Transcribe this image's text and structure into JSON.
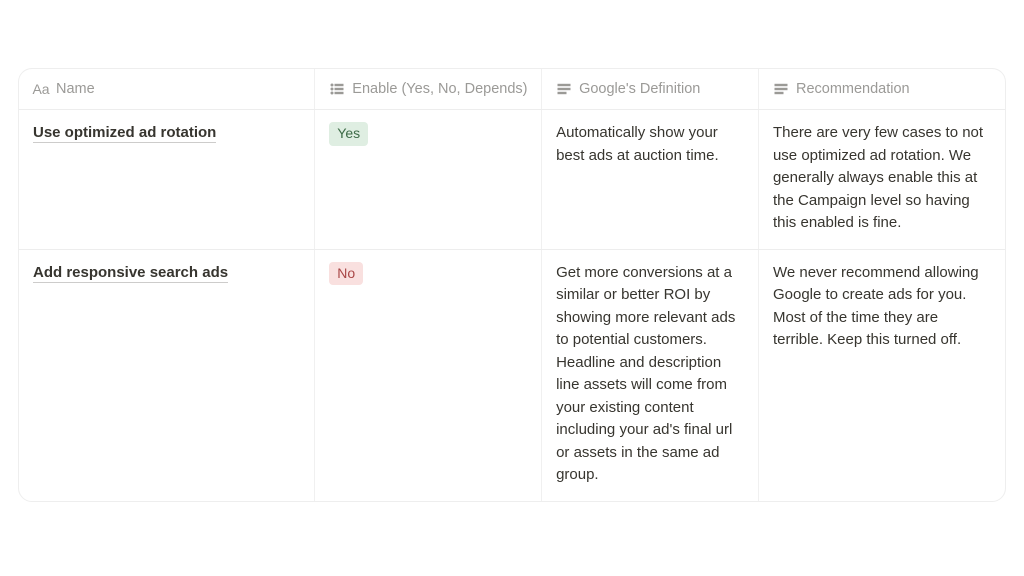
{
  "columns": {
    "name": "Name",
    "enable": "Enable (Yes, No, Depends)",
    "definition": "Google's Definition",
    "recommendation": "Recommendation"
  },
  "tags": {
    "yes": "Yes",
    "no": "No"
  },
  "rows": [
    {
      "name": "Use optimized ad rotation",
      "enable": "Yes",
      "definition": "Automatically show your best ads at auction time.",
      "recommendation": "There are very few cases to not use optimized ad rotation. We generally always enable this at the Campaign level so having this enabled is fine."
    },
    {
      "name": "Add responsive search ads",
      "enable": "No",
      "definition": "Get more conversions at a similar or better ROI by showing more relevant ads to potential customers. Headline and description line assets will come from your existing content including your ad's final url or assets in the same ad group.",
      "recommendation": "We never recommend allowing Google to create ads for you. Most of the time they are terrible. Keep this turned off."
    }
  ]
}
